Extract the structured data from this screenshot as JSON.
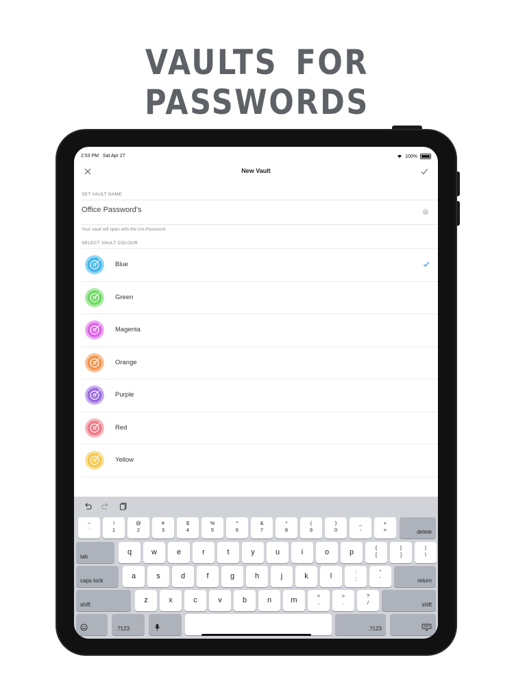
{
  "headline": "VAULTS FOR PASSWORDS",
  "status": {
    "time": "2:53 PM",
    "date": "Sat Apr 27",
    "battery": "100%"
  },
  "nav": {
    "title": "New Vault"
  },
  "vault_name": {
    "section_label": "SET VAULT NAME",
    "value": "Office Password's",
    "hint": "Your vault will open with the Uni-Password."
  },
  "colour_section_label": "SELECT VAULT COLOUR",
  "colors": [
    {
      "name": "Blue",
      "hex": "#3fb6ee",
      "selected": true
    },
    {
      "name": "Green",
      "hex": "#6ed863",
      "selected": false
    },
    {
      "name": "Magenta",
      "hex": "#dc62e6",
      "selected": false
    },
    {
      "name": "Orange",
      "hex": "#f1944a",
      "selected": false
    },
    {
      "name": "Purple",
      "hex": "#9a6ae0",
      "selected": false
    },
    {
      "name": "Red",
      "hex": "#ee7a86",
      "selected": false
    },
    {
      "name": "Yellow",
      "hex": "#f5c84a",
      "selected": false
    }
  ],
  "accent": "#3d8de3",
  "keyboard": {
    "row1": [
      [
        "~",
        "`"
      ],
      [
        "!",
        "1"
      ],
      [
        "@",
        "2"
      ],
      [
        "#",
        "3"
      ],
      [
        "$",
        "4"
      ],
      [
        "%",
        "5"
      ],
      [
        "^",
        "6"
      ],
      [
        "&",
        "7"
      ],
      [
        "*",
        "8"
      ],
      [
        "(",
        "9"
      ],
      [
        ")",
        "0"
      ],
      [
        "_",
        "-"
      ],
      [
        "+",
        "="
      ]
    ],
    "delete": "delete",
    "tab": "tab",
    "row2": [
      "q",
      "w",
      "e",
      "r",
      "t",
      "y",
      "u",
      "i",
      "o",
      "p"
    ],
    "row2_sym": [
      [
        "{",
        "["
      ],
      [
        "}",
        "]"
      ],
      [
        "|",
        "\\"
      ]
    ],
    "caps": "caps lock",
    "row3": [
      "a",
      "s",
      "d",
      "f",
      "g",
      "h",
      "j",
      "k",
      "l"
    ],
    "row3_sym": [
      [
        ":",
        ";"
      ],
      [
        "\"",
        "'"
      ]
    ],
    "return": "return",
    "shift": "shift",
    "row4": [
      "z",
      "x",
      "c",
      "v",
      "b",
      "n",
      "m"
    ],
    "row4_sym": [
      [
        "<",
        ","
      ],
      [
        ">",
        "."
      ],
      [
        "?",
        "/"
      ]
    ],
    "num": ".?123"
  }
}
